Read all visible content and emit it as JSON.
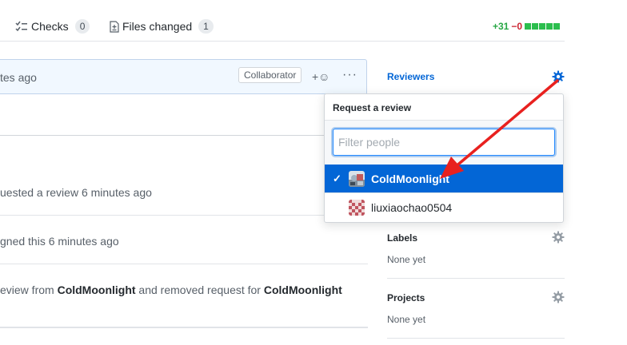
{
  "tabs": {
    "checks": {
      "label": "Checks",
      "count": "0"
    },
    "files": {
      "label": "Files changed",
      "count": "1"
    },
    "diffstat": {
      "additions": "+31",
      "deletions": "−0"
    }
  },
  "comment": {
    "header_text": "tes ago",
    "badge": "Collaborator",
    "reaction": "+☺",
    "more": "···"
  },
  "timeline": {
    "item1": "uested a review 6 minutes ago",
    "item2": "gned this 6 minutes ago",
    "item3_a": "eview from ",
    "item3_b": "ColdMoonlight",
    "item3_c": " and removed request for ",
    "item3_d": "ColdMoonlight"
  },
  "sidebar": {
    "reviewers": "Reviewers",
    "labels": "Labels",
    "labels_value": "None yet",
    "projects": "Projects",
    "projects_value": "None yet"
  },
  "dropdown": {
    "title": "Request a review",
    "filter_placeholder": "Filter people",
    "items": [
      {
        "name": "ColdMoonlight",
        "selected": true
      },
      {
        "name": "liuxiaochao0504",
        "selected": false
      }
    ]
  },
  "colors": {
    "accent": "#0366d6",
    "arrow": "#e8211f",
    "additions": "#28a745",
    "deletions": "#cb2431"
  }
}
